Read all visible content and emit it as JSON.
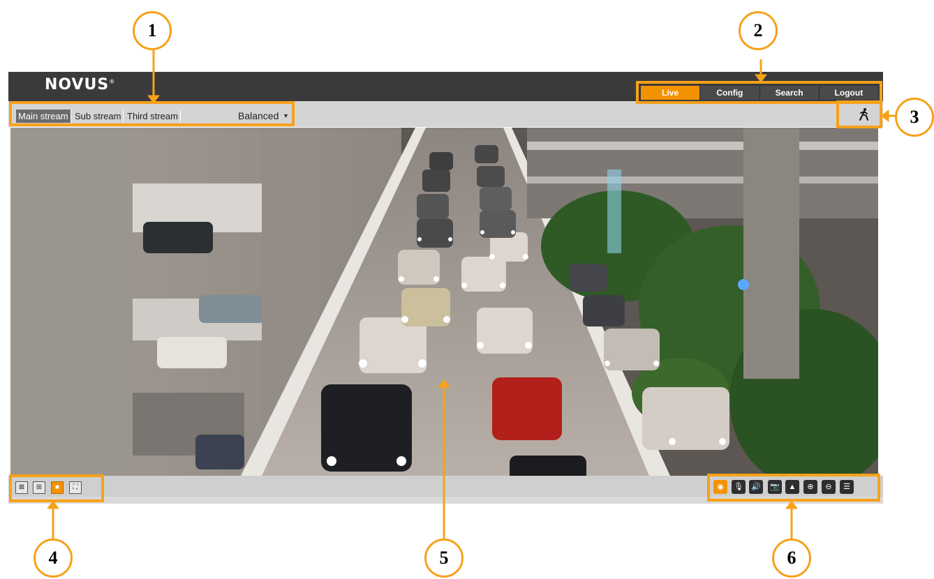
{
  "brand": {
    "logo_text": "NOVUS"
  },
  "nav": {
    "tabs": [
      "Live",
      "Config",
      "Search",
      "Logout"
    ],
    "active": "Live"
  },
  "stream": {
    "tabs": [
      "Main stream",
      "Sub stream",
      "Third stream"
    ],
    "active": "Main stream",
    "quality": "Balanced"
  },
  "icons": {
    "alarm": "running-person-icon",
    "view_left": [
      "original-size-icon",
      "fit-window-icon",
      "auto-icon",
      "fullscreen-icon"
    ],
    "view_right": [
      "eye-icon",
      "microphone-icon",
      "speaker-icon",
      "snapshot-camera-icon",
      "record-icon",
      "zoom-in-icon",
      "zoom-out-icon",
      "face-detection-icon"
    ]
  },
  "callouts": [
    "1",
    "2",
    "3",
    "4",
    "5",
    "6"
  ],
  "colors": {
    "accent": "#f39200",
    "callout": "#f7a11a",
    "header": "#3a3a3a",
    "toolbar": "#d4d4d4"
  }
}
